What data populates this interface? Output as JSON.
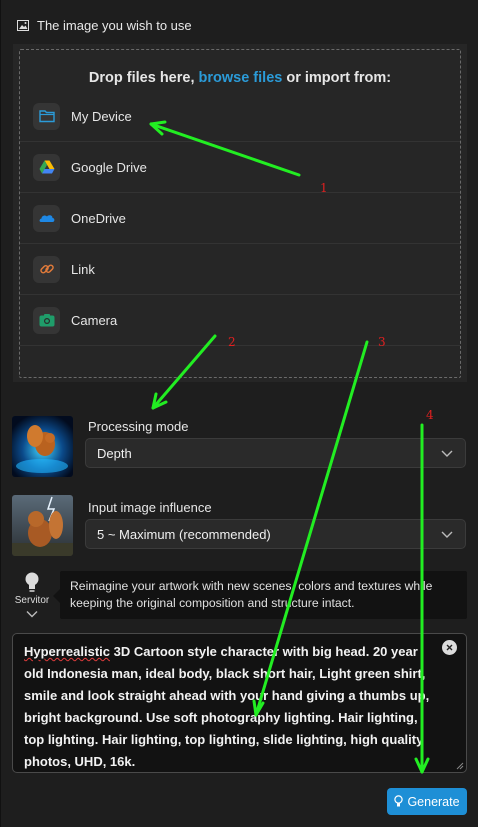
{
  "header": {
    "title": "The image you wish to use",
    "icon": "image-icon"
  },
  "upload": {
    "drop_prefix": "Drop files here,",
    "browse_link": "browse files",
    "drop_suffix": "or import from:",
    "sources": [
      {
        "label": "My Device",
        "icon": "folder-icon",
        "color": "#2b9bd8"
      },
      {
        "label": "Google Drive",
        "icon": "google-drive-icon",
        "color": "#34a853"
      },
      {
        "label": "OneDrive",
        "icon": "onedrive-icon",
        "color": "#1e88e5"
      },
      {
        "label": "Link",
        "icon": "link-icon",
        "color": "#e07a3a"
      },
      {
        "label": "Camera",
        "icon": "camera-icon",
        "color": "#1f9d6a"
      }
    ]
  },
  "processing_mode": {
    "label": "Processing mode",
    "value": "Depth"
  },
  "influence": {
    "label": "Input image influence",
    "value": "5 ~ Maximum (recommended)"
  },
  "servitor": {
    "label": "Servitor",
    "tooltip": "Reimagine your artwork with new scenes, colors and textures while keeping the original composition and structure intact."
  },
  "prompt": {
    "first_word": "Hyperrealistic",
    "rest": " 3D Cartoon style character with big head. 20 year old Indonesia man, ideal body, black short hair, Light green shirt, smile and look straight ahead with your hand giving a thumbs up, bright background. Use soft photography lighting. Hair lighting, top lighting. Hair lighting, top lighting, slide lighting, high quality photos, UHD, 16k."
  },
  "generate": {
    "label": "Generate"
  },
  "annotations": {
    "a1": "1",
    "a2": "2",
    "a3": "3",
    "a4": "4",
    "arrow_color": "#22ee22",
    "number_color": "#e02020"
  },
  "colors": {
    "accent": "#1e8fd6",
    "link": "#2b9bd8",
    "background": "#1e1e1e"
  }
}
